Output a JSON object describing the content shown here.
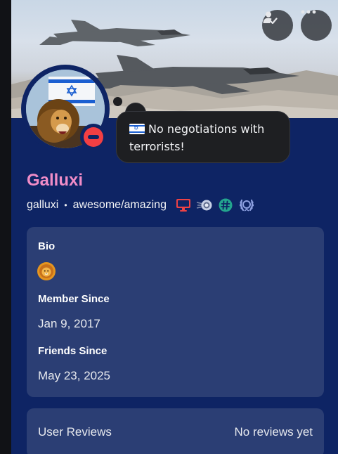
{
  "profile": {
    "display_name": "Galluxi",
    "username": "galluxi",
    "separator": "•",
    "pronouns": "awesome/amazing",
    "custom_status": {
      "text": "No negotiations with terrorists!",
      "emoji": "israel-flag"
    },
    "presence": "do-not-disturb"
  },
  "colors": {
    "profile_background": "#0e2464",
    "display_name": "#f08cc7",
    "dnd_status": "#f23f43",
    "panel": "#2b3e74"
  },
  "header_buttons": [
    {
      "name": "add-friend",
      "icon": "person-check-icon"
    },
    {
      "name": "more-options",
      "icon": "ellipsis-icon"
    }
  ],
  "badges": [
    {
      "name": "active-developer",
      "icon": "monitor-icon",
      "color": "#ed4245"
    },
    {
      "name": "quest",
      "icon": "orb-icon",
      "color": "#c7d0e6"
    },
    {
      "name": "hashtag",
      "icon": "hashtag-icon",
      "color": "#23a58e"
    },
    {
      "name": "hypesquad",
      "icon": "laurel-icon",
      "color": "#8ea1e1"
    }
  ],
  "about": {
    "bio_label": "Bio",
    "bio_emoji": "lion-face",
    "member_since_label": "Member Since",
    "member_since": "Jan 9, 2017",
    "friends_since_label": "Friends Since",
    "friends_since": "May 23, 2025"
  },
  "reviews": {
    "title": "User Reviews",
    "value": "No reviews yet"
  }
}
